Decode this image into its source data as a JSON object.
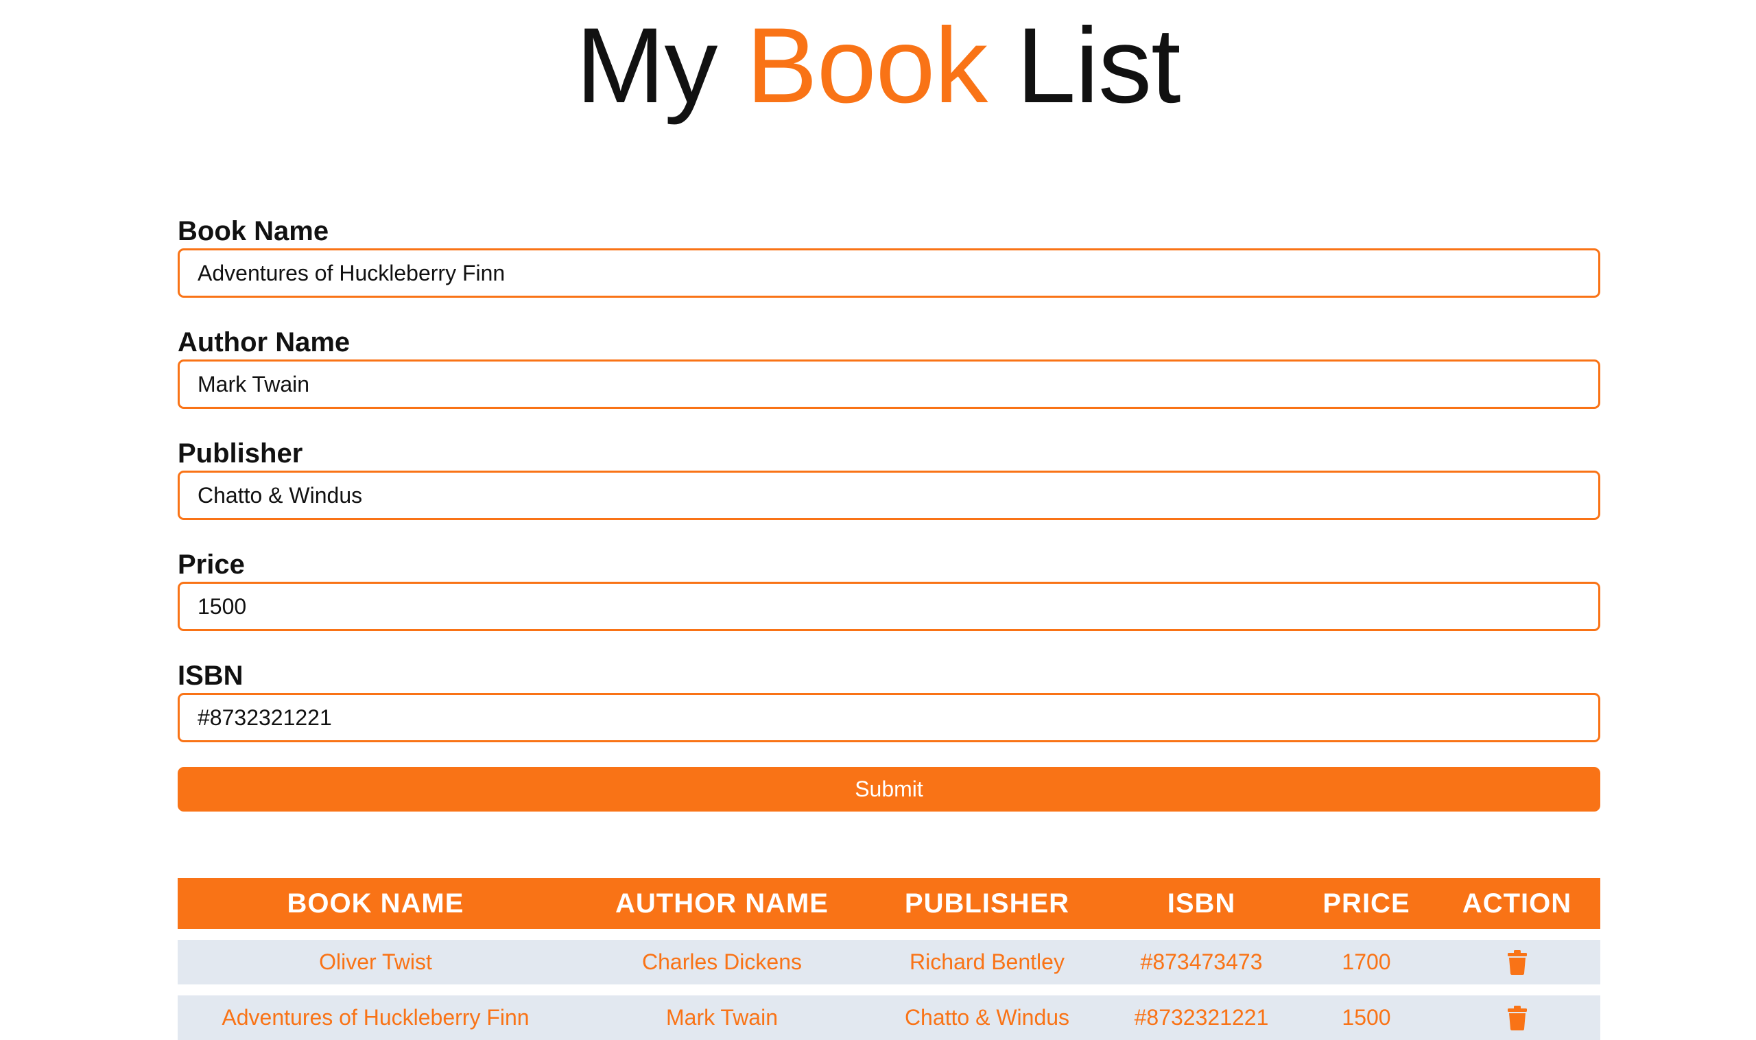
{
  "title": {
    "part1": "My ",
    "accent": "Book",
    "part2": " List"
  },
  "form": {
    "fields": [
      {
        "label": "Book Name",
        "value": "Adventures of Huckleberry Finn"
      },
      {
        "label": "Author Name",
        "value": "Mark Twain"
      },
      {
        "label": "Publisher",
        "value": "Chatto & Windus"
      },
      {
        "label": "Price",
        "value": "1500"
      },
      {
        "label": "ISBN",
        "value": "#8732321221"
      }
    ],
    "submit_label": "Submit"
  },
  "table": {
    "headers": [
      "BOOK NAME",
      "AUTHOR NAME",
      "PUBLISHER",
      "ISBN",
      "PRICE",
      "ACTION"
    ],
    "rows": [
      {
        "book": "Oliver Twist",
        "author": "Charles Dickens",
        "publisher": "Richard Bentley",
        "isbn": "#873473473",
        "price": "1700",
        "action_icon": "trash-icon"
      },
      {
        "book": "Adventures of Huckleberry Finn",
        "author": "Mark Twain",
        "publisher": "Chatto & Windus",
        "isbn": "#8732321221",
        "price": "1500",
        "action_icon": "trash-icon"
      }
    ]
  },
  "colors": {
    "accent": "#f97316",
    "row_bg": "#e2e8f0"
  }
}
